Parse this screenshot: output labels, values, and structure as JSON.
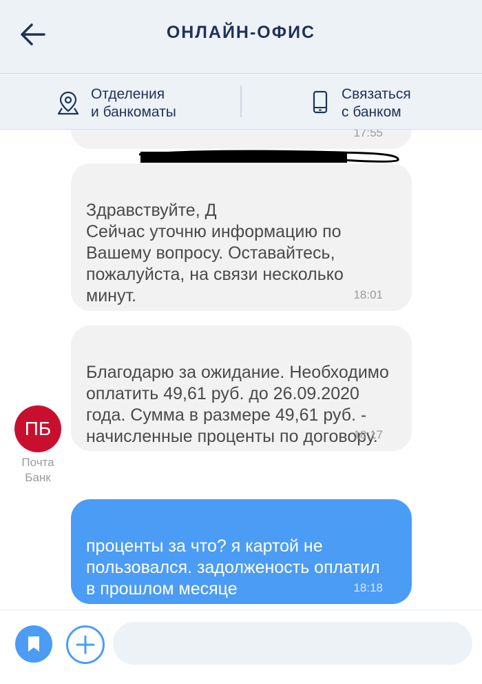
{
  "header": {
    "title": "ОНЛАЙН-ОФИС",
    "back_icon": "arrow-left-icon"
  },
  "subnav": {
    "branches": {
      "line1": "Отделения",
      "line2": "и банкоматы",
      "icon": "map-pin-icon"
    },
    "contact": {
      "line1": "Связаться",
      "line2": "с банком",
      "icon": "phone-icon"
    }
  },
  "messages": [
    {
      "from": "bank",
      "text": "",
      "time": "17:55"
    },
    {
      "from": "bank",
      "text": "Здравствуйте, Д\nСейчас уточню информацию по\nВашему вопросу. Оставайтесь,\nпожалуйста, на связи несколько\nминут.",
      "time": "18:01"
    },
    {
      "from": "bank",
      "text": "Благодарю за ожидание. Необходимо\nоплатить 49,61 руб. до 26.09.2020\nгода. Сумма в размере 49,61 руб. -\nначисленные проценты по договору.",
      "time": "18:17"
    },
    {
      "from": "user",
      "text": "проценты за что? я картой не\nпользовался. задолженость оплатил\nв прошлом месяце",
      "time": "18:18"
    }
  ],
  "bank_sender": {
    "initials": "ПБ",
    "name_line1": "Почта",
    "name_line2": "Банк"
  },
  "composer": {
    "placeholder": "",
    "bookmark_icon": "bookmark-icon",
    "add_icon": "plus-icon"
  },
  "colors": {
    "accent": "#4b9cf5",
    "brand": "#c8102e",
    "header_bg": "#edf2f7",
    "title": "#1d3257"
  }
}
